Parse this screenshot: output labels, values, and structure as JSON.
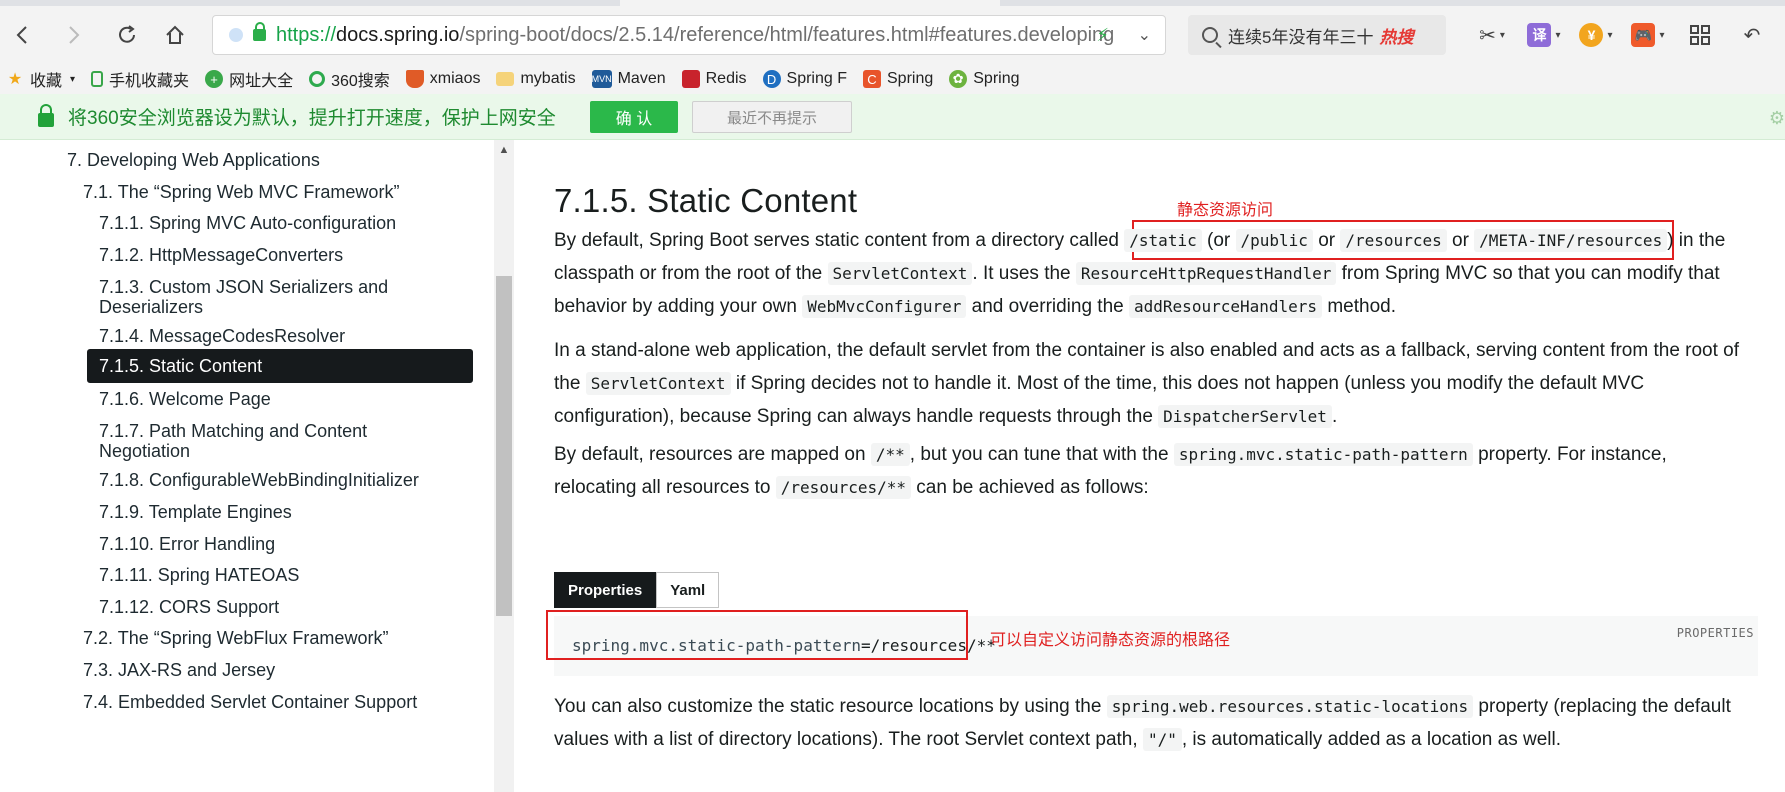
{
  "browser": {
    "url_scheme": "https://",
    "url_host": "docs.spring.io",
    "url_path": "/spring-boot/docs/2.5.14/reference/html/features.html#features.developing",
    "search_text": "连续5年没有年三十",
    "search_badge": "热搜",
    "toolbar_icons": [
      "scissors-icon",
      "translate-icon",
      "coin-icon",
      "game-icon",
      "grid-icon",
      "undo-icon"
    ]
  },
  "bookmarks": [
    {
      "label": "收藏",
      "icon": "star-icon"
    },
    {
      "label": "手机收藏夹",
      "icon": "phone-icon"
    },
    {
      "label": "网址大全",
      "icon": "nav-icon"
    },
    {
      "label": "360搜索",
      "icon": "search360-icon"
    },
    {
      "label": "xmiaos",
      "icon": "xm-icon"
    },
    {
      "label": "mybatis",
      "icon": "folder-icon"
    },
    {
      "label": "Maven",
      "icon": "maven-icon"
    },
    {
      "label": "Redis",
      "icon": "redis-icon"
    },
    {
      "label": "Spring F",
      "icon": "spring-d-icon"
    },
    {
      "label": "Spring",
      "icon": "spring-c-icon"
    },
    {
      "label": "Spring",
      "icon": "spring-leaf-icon"
    }
  ],
  "infobar": {
    "message": "将360安全浏览器设为默认，提升打开速度，保护上网安全",
    "confirm_label": "确 认",
    "dismiss_label": "最近不再提示"
  },
  "toc": [
    {
      "label": "7. Developing Web Applications"
    },
    {
      "label": "7.1. The “Spring Web MVC Framework”"
    },
    {
      "label": "7.1.1. Spring MVC Auto-configuration"
    },
    {
      "label": "7.1.2. HttpMessageConverters"
    },
    {
      "label": "7.1.3. Custom JSON Serializers and Deserializers"
    },
    {
      "label": "7.1.4. MessageCodesResolver"
    },
    {
      "label": "7.1.5. Static Content"
    },
    {
      "label": "7.1.6. Welcome Page"
    },
    {
      "label": "7.1.7. Path Matching and Content Negotiation"
    },
    {
      "label": "7.1.8. ConfigurableWebBindingInitializer"
    },
    {
      "label": "7.1.9. Template Engines"
    },
    {
      "label": "7.1.10. Error Handling"
    },
    {
      "label": "7.1.11. Spring HATEOAS"
    },
    {
      "label": "7.1.12. CORS Support"
    },
    {
      "label": "7.2. The “Spring WebFlux Framework”"
    },
    {
      "label": "7.3. JAX-RS and Jersey"
    },
    {
      "label": "7.4. Embedded Servlet Container Support"
    }
  ],
  "content": {
    "heading": "7.1.5. Static Content",
    "annotation_static": "静态资源访问",
    "annotation_path": "可以自定义访问静态资源的根路径",
    "p1": {
      "t1": "By default, Spring Boot serves static content from a directory called ",
      "c1": "/static",
      "t2": " (or ",
      "c2": "/public",
      "t3": " or ",
      "c3": "/resources",
      "t4": " or ",
      "c4": "/META-INF/resources",
      "t5": ") in the classpath or from the root of the ",
      "c5": "ServletContext",
      "t6": ". It uses the ",
      "c6": "ResourceHttpRequestHandler",
      "t7": " from Spring MVC so that you can modify that behavior by adding your own ",
      "c7": "WebMvcConfigurer",
      "t8": " and overriding the ",
      "c8": "addResourceHandlers",
      "t9": " method."
    },
    "p2": {
      "t1": "In a stand-alone web application, the default servlet from the container is also enabled and acts as a fallback, serving content from the root of the ",
      "c1": "ServletContext",
      "t2": " if Spring decides not to handle it. Most of the time, this does not happen (unless you modify the default MVC configuration), because Spring can always handle requests through the ",
      "c2": "DispatcherServlet",
      "t3": "."
    },
    "p3": {
      "t1": "By default, resources are mapped on ",
      "c1": "/**",
      "t2": ", but you can tune that with the ",
      "c2": "spring.mvc.static-path-pattern",
      "t3": " property. For instance, relocating all resources to ",
      "c3": "/resources/**",
      "t4": " can be achieved as follows:"
    },
    "tabs": [
      "Properties",
      "Yaml"
    ],
    "code_lang": "PROPERTIES",
    "code_key": "spring.mvc.static-path-pattern",
    "code_value": "=/resources/**",
    "p4": {
      "t1": "You can also customize the static resource locations by using the ",
      "c1": "spring.web.resources.static-locations",
      "t2": " property (replacing the default values with a list of directory locations). The root Servlet context path, ",
      "c2": "\"/\"",
      "t3": ", is automatically added as a location as well."
    }
  }
}
